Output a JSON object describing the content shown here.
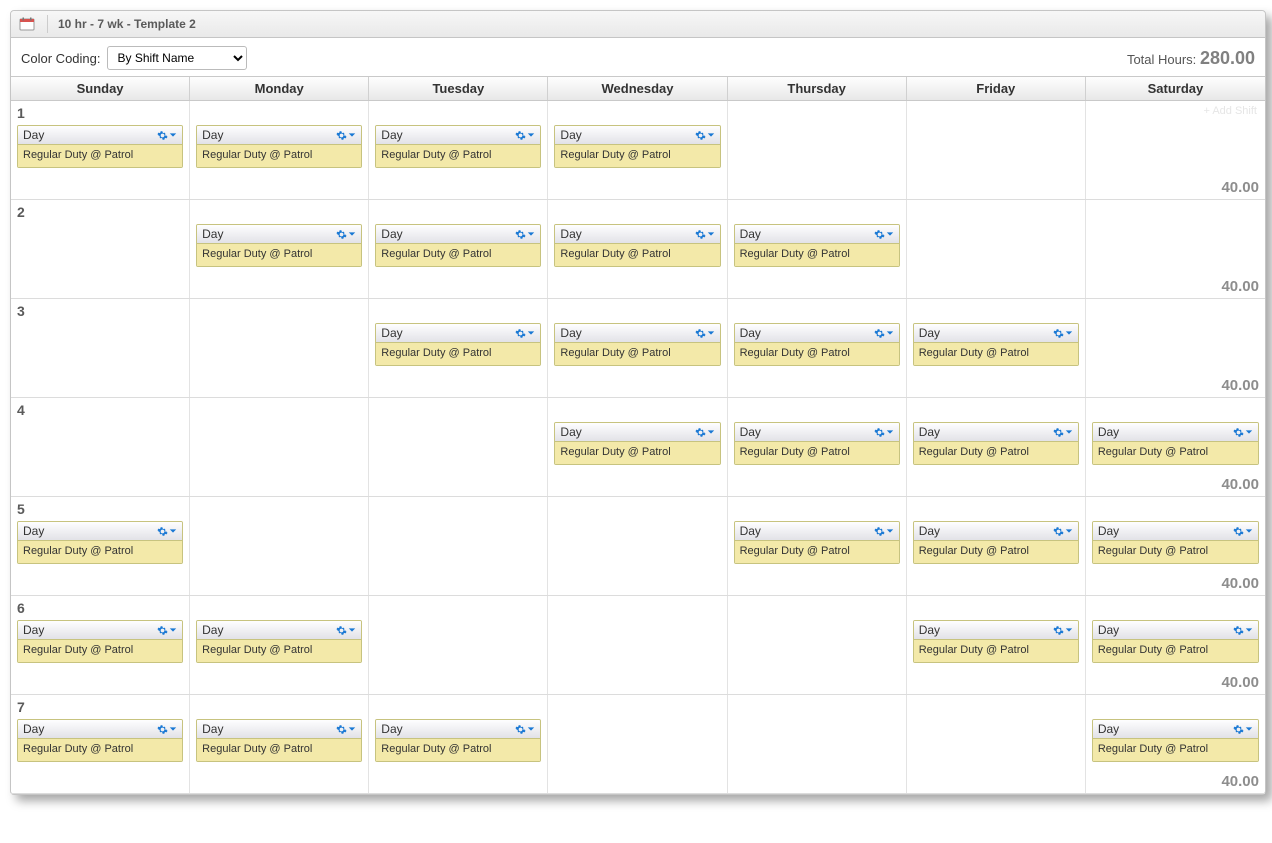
{
  "title": "10 hr - 7 wk - Template 2",
  "toolbar": {
    "color_coding_label": "Color Coding:",
    "color_coding_value": "By Shift Name",
    "total_hours_label": "Total Hours:",
    "total_hours_value": "280.00",
    "add_shift_label": "+ Add Shift"
  },
  "days": [
    "Sunday",
    "Monday",
    "Tuesday",
    "Wednesday",
    "Thursday",
    "Friday",
    "Saturday"
  ],
  "shift": {
    "name": "Day",
    "detail": "Regular Duty @ Patrol"
  },
  "weeks": [
    {
      "num": "1",
      "total": "40.00",
      "cells": [
        true,
        true,
        true,
        true,
        false,
        false,
        false
      ]
    },
    {
      "num": "2",
      "total": "40.00",
      "cells": [
        false,
        true,
        true,
        true,
        true,
        false,
        false
      ]
    },
    {
      "num": "3",
      "total": "40.00",
      "cells": [
        false,
        false,
        true,
        true,
        true,
        true,
        false
      ]
    },
    {
      "num": "4",
      "total": "40.00",
      "cells": [
        false,
        false,
        false,
        true,
        true,
        true,
        true
      ]
    },
    {
      "num": "5",
      "total": "40.00",
      "cells": [
        true,
        false,
        false,
        false,
        true,
        true,
        true
      ]
    },
    {
      "num": "6",
      "total": "40.00",
      "cells": [
        true,
        true,
        false,
        false,
        false,
        true,
        true
      ]
    },
    {
      "num": "7",
      "total": "40.00",
      "cells": [
        true,
        true,
        true,
        false,
        false,
        false,
        true
      ]
    }
  ],
  "icons": {
    "gear": "gear-icon",
    "caret": "caret-down-icon",
    "calendar": "calendar-icon"
  }
}
